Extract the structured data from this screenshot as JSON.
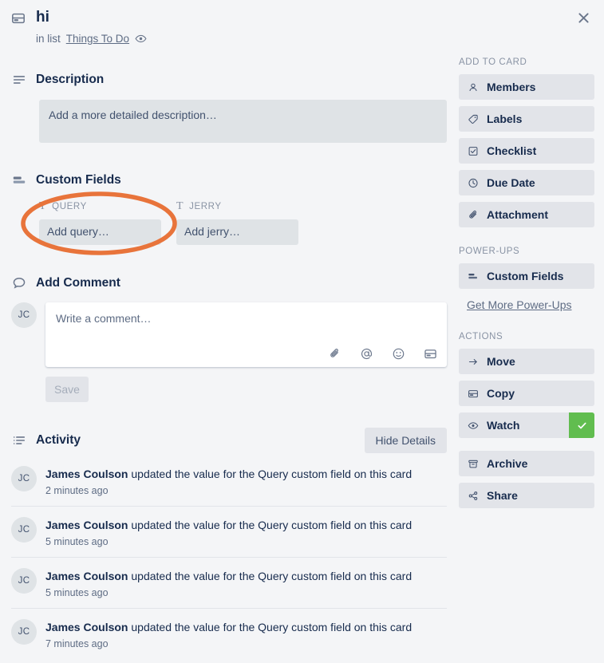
{
  "header": {
    "card_icon": "card-icon",
    "title": "hi",
    "in_list_prefix": "in list",
    "list_name": "Things To Do",
    "watch_eye_icon": "eye-icon",
    "close_icon": "close-icon"
  },
  "description": {
    "icon": "description-lines-icon",
    "title": "Description",
    "placeholder": "Add a more detailed description…"
  },
  "custom_fields": {
    "icon": "custom-fields-icon",
    "title": "Custom Fields",
    "fields": [
      {
        "label": "QUERY",
        "type_icon": "text-type-icon",
        "placeholder": "Add query…"
      },
      {
        "label": "JERRY",
        "type_icon": "text-type-icon",
        "placeholder": "Add jerry…"
      }
    ]
  },
  "annotation": {
    "shape": "ellipse-highlight",
    "color": "#e8743b",
    "target": "query-custom-field"
  },
  "add_comment": {
    "icon": "comment-bubble-icon",
    "title": "Add Comment",
    "avatar_initials": "JC",
    "placeholder": "Write a comment…",
    "tools": [
      "attachment-icon",
      "mention-icon",
      "emoji-icon",
      "card-icon"
    ],
    "save_label": "Save"
  },
  "activity": {
    "icon": "activity-list-icon",
    "title": "Activity",
    "hide_details_label": "Hide Details",
    "items": [
      {
        "avatar": "JC",
        "actor": "James Coulson",
        "action": "updated the value for the Query custom field on this card",
        "time": "2 minutes ago"
      },
      {
        "avatar": "JC",
        "actor": "James Coulson",
        "action": "updated the value for the Query custom field on this card",
        "time": "5 minutes ago"
      },
      {
        "avatar": "JC",
        "actor": "James Coulson",
        "action": "updated the value for the Query custom field on this card",
        "time": "5 minutes ago"
      },
      {
        "avatar": "JC",
        "actor": "James Coulson",
        "action": "updated the value for the Query custom field on this card",
        "time": "7 minutes ago"
      }
    ]
  },
  "sidebar": {
    "add_to_card": {
      "heading": "ADD TO CARD",
      "items": [
        {
          "label": "Members",
          "icon": "person-icon"
        },
        {
          "label": "Labels",
          "icon": "label-tag-icon"
        },
        {
          "label": "Checklist",
          "icon": "checkbox-icon"
        },
        {
          "label": "Due Date",
          "icon": "clock-icon"
        },
        {
          "label": "Attachment",
          "icon": "paperclip-icon"
        }
      ]
    },
    "power_ups": {
      "heading": "POWER-UPS",
      "items": [
        {
          "label": "Custom Fields",
          "icon": "custom-fields-icon"
        }
      ],
      "more_link": "Get More Power-Ups"
    },
    "actions": {
      "heading": "ACTIONS",
      "items": [
        {
          "label": "Move",
          "icon": "arrow-right-icon",
          "checked": false
        },
        {
          "label": "Copy",
          "icon": "card-icon",
          "checked": false
        },
        {
          "label": "Watch",
          "icon": "eye-icon",
          "checked": true
        },
        {
          "label": "Archive",
          "icon": "archive-box-icon",
          "checked": false
        },
        {
          "label": "Share",
          "icon": "share-nodes-icon",
          "checked": false
        }
      ],
      "watch_check_color": "#61bd4f"
    }
  }
}
